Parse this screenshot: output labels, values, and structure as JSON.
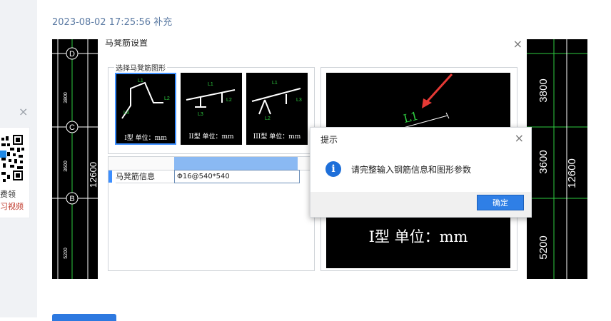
{
  "page": {
    "timestamp": "2023-08-02 17:25:56 补充"
  },
  "side_ad": {
    "close_symbol": "×",
    "line1": "费领",
    "line2": "习视频"
  },
  "cad": {
    "axis_labels": [
      "D",
      "C",
      "B"
    ],
    "left_dims": [
      "3800",
      "3600",
      "12600",
      "5200"
    ],
    "right_dims": [
      "3800",
      "3600",
      "12600",
      "5200"
    ]
  },
  "window": {
    "title": "马凳筋设置",
    "close_symbol": "×",
    "group_label": "选择马凳筋图形",
    "shapes": [
      {
        "caption": "I型 单位：mm",
        "selected": true
      },
      {
        "caption": "II型 单位：mm",
        "selected": false
      },
      {
        "caption": "III型 单位：mm",
        "selected": false
      }
    ],
    "grid": {
      "row_label": "马凳筋信息",
      "row_value": "Φ16@540*540"
    },
    "preview": {
      "label": "L1",
      "caption": "I型 单位：mm"
    }
  },
  "dialog": {
    "title": "提示",
    "close_symbol": "×",
    "icon": "info-icon",
    "message": "请完整输入钢筋信息和图形参数",
    "ok_label": "确定"
  },
  "colors": {
    "accent": "#2f7fe6",
    "cad_background": "#000000",
    "cad_green": "#2ecc40",
    "arrow_red": "#e53935"
  }
}
